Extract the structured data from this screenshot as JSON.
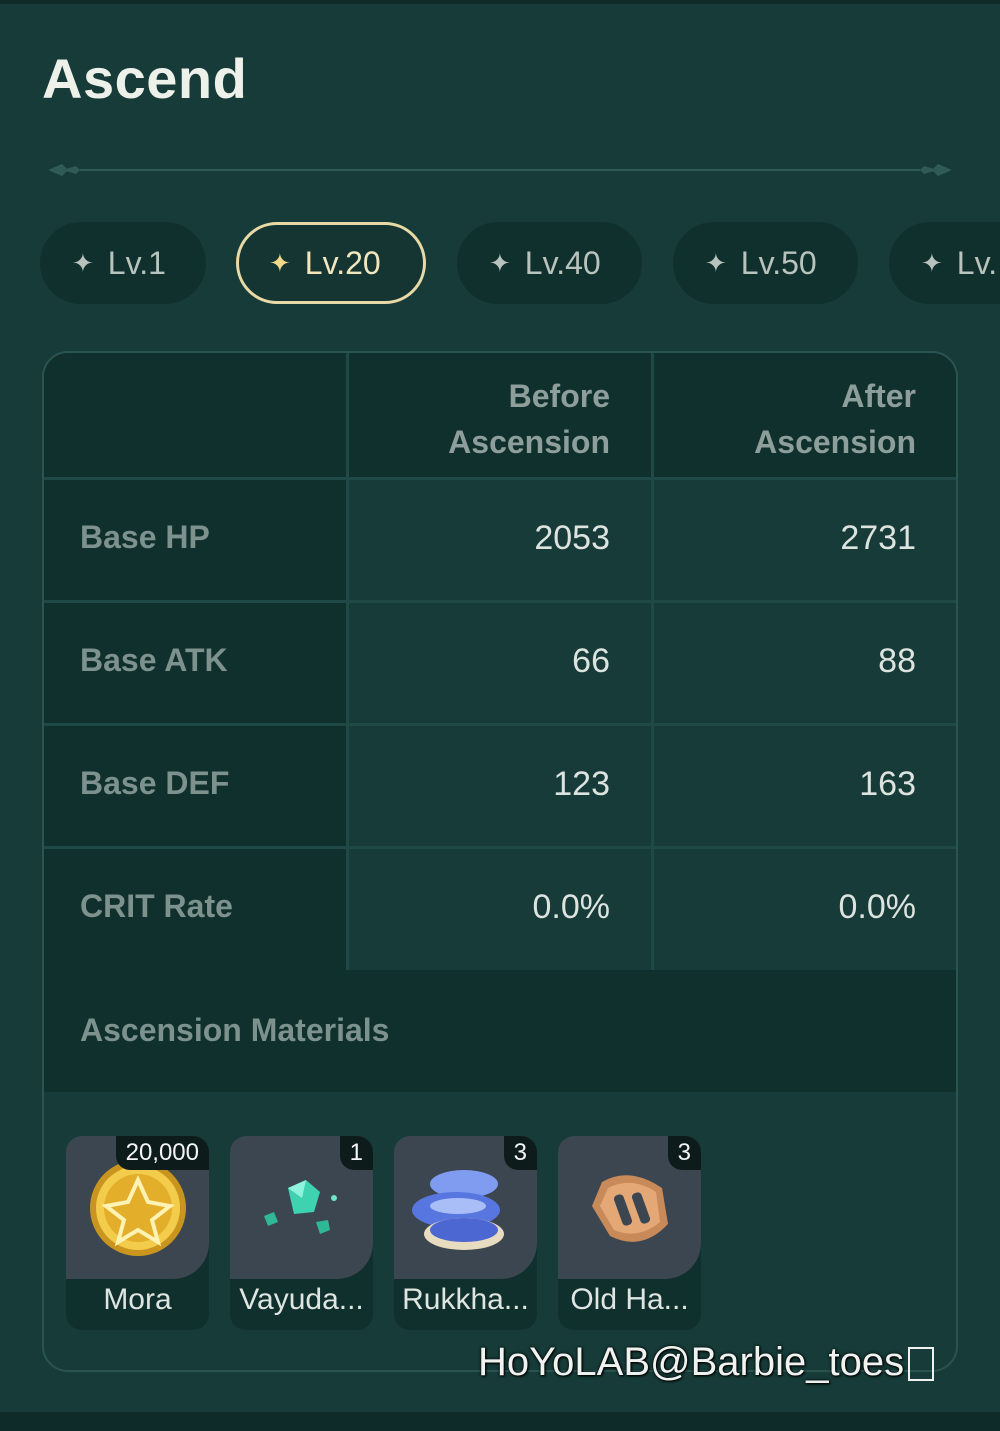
{
  "page_title": "Ascend",
  "tabs": [
    {
      "label": "Lv.1",
      "active": false
    },
    {
      "label": "Lv.20",
      "active": true
    },
    {
      "label": "Lv.40",
      "active": false
    },
    {
      "label": "Lv.50",
      "active": false
    },
    {
      "label": "Lv.",
      "active": false
    }
  ],
  "table": {
    "col_before": "Before Ascension",
    "col_after": "After Ascension",
    "rows": [
      {
        "label": "Base HP",
        "before": "2053",
        "after": "2731"
      },
      {
        "label": "Base ATK",
        "before": "66",
        "after": "88"
      },
      {
        "label": "Base DEF",
        "before": "123",
        "after": "163"
      },
      {
        "label": "CRIT Rate",
        "before": "0.0%",
        "after": "0.0%"
      }
    ]
  },
  "materials": {
    "title": "Ascension Materials",
    "items": [
      {
        "name": "Mora",
        "count": "20,000",
        "icon": "mora-coin-icon"
      },
      {
        "name": "Vayuda...",
        "count": "1",
        "icon": "vayuda-gem-icon"
      },
      {
        "name": "Rukkha...",
        "count": "3",
        "icon": "rukkhashava-mushroom-icon"
      },
      {
        "name": "Old Ha...",
        "count": "3",
        "icon": "old-handguard-icon"
      }
    ]
  },
  "watermark": "HoYoLAB@Barbie_toes",
  "colors": {
    "background": "#163b38",
    "active_tab_border": "#e8d9a6",
    "header_text": "#8e9e9a"
  }
}
